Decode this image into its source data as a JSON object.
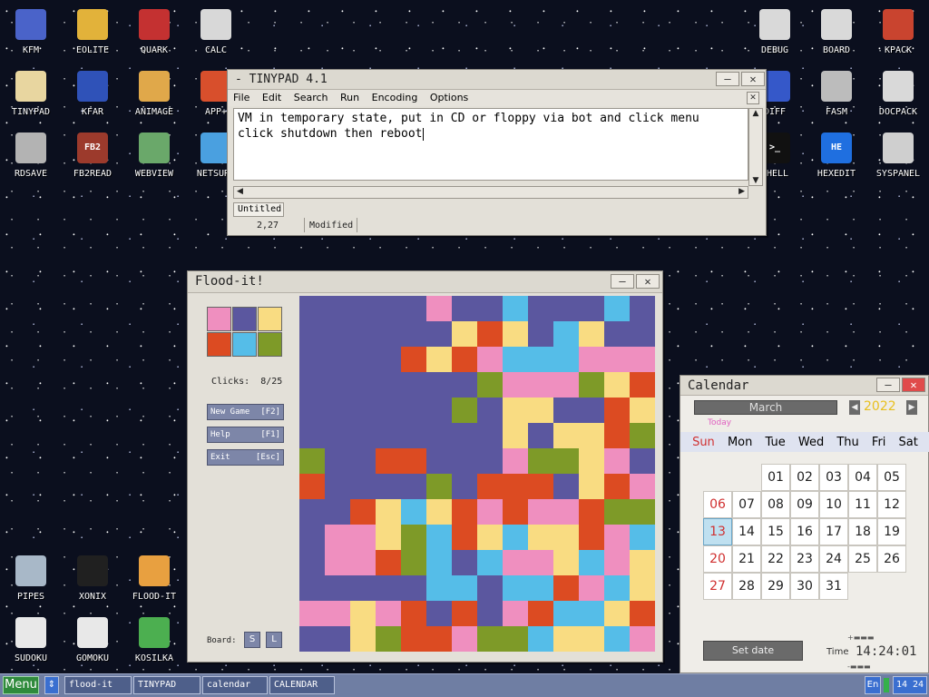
{
  "desktop": {
    "icons": [
      {
        "label": "KFM",
        "glyph": "floppy",
        "color": "#4a63c9",
        "col": 0,
        "row": 0
      },
      {
        "label": "EOLITE",
        "glyph": "folder",
        "color": "#e2b23a",
        "col": 1,
        "row": 0
      },
      {
        "label": "QUARK",
        "glyph": "book",
        "color": "#c43131",
        "col": 2,
        "row": 0
      },
      {
        "label": "CALC",
        "glyph": "calculator",
        "color": "#d8d8d8",
        "col": 3,
        "row": 0
      },
      {
        "label": "TINYPAD",
        "glyph": "notepad",
        "color": "#e8d6a0",
        "col": 0,
        "row": 1
      },
      {
        "label": "KFAR",
        "glyph": "panels",
        "color": "#2f52b8",
        "col": 1,
        "row": 1
      },
      {
        "label": "ANIMAGE",
        "glyph": "pencil",
        "color": "#e0a84a",
        "col": 2,
        "row": 1
      },
      {
        "label": "APP+",
        "glyph": "cube",
        "color": "#d84f2c",
        "col": 3,
        "row": 1
      },
      {
        "label": "RDSAVE",
        "glyph": "disk",
        "color": "#b3b3b3",
        "col": 0,
        "row": 2
      },
      {
        "label": "FB2READ",
        "glyph": "FB2",
        "color": "#9c3a2c",
        "col": 1,
        "row": 2
      },
      {
        "label": "WEBVIEW",
        "glyph": "globe",
        "color": "#6aa86a",
        "col": 2,
        "row": 2
      },
      {
        "label": "NETSURF",
        "glyph": "net",
        "color": "#4aa0e0",
        "col": 3,
        "row": 2
      },
      {
        "label": "DEBUG",
        "glyph": "bug",
        "color": "#d9d9d9",
        "col": "r2",
        "row": 0
      },
      {
        "label": "BOARD",
        "glyph": "board",
        "color": "#d9d9d9",
        "col": "r1",
        "row": 0
      },
      {
        "label": "KPACK",
        "glyph": "wrench",
        "color": "#c9442f",
        "col": "r0",
        "row": 0
      },
      {
        "label": "DIFF",
        "glyph": "diff",
        "color": "#3558c9",
        "col": "r2",
        "row": 1
      },
      {
        "label": "FASM",
        "glyph": "fasm",
        "color": "#bcbcbc",
        "col": "r1",
        "row": 1
      },
      {
        "label": "DOCPACK",
        "glyph": "cabinet",
        "color": "#d9d9d9",
        "col": "r0",
        "row": 1
      },
      {
        "label": "SHELL",
        "glyph": ">_",
        "color": "#111111",
        "col": "r2",
        "row": 2
      },
      {
        "label": "HEXEDIT",
        "glyph": "HE",
        "color": "#1f6fe0",
        "col": "r1",
        "row": 2
      },
      {
        "label": "SYSPANEL",
        "glyph": "sliders",
        "color": "#cfcfcf",
        "col": "r0",
        "row": 2
      },
      {
        "label": "PIPES",
        "glyph": "pipes",
        "color": "#a8b8c8",
        "col": 0,
        "row": 3
      },
      {
        "label": "XONIX",
        "glyph": "xonix",
        "color": "#202020",
        "col": 1,
        "row": 3
      },
      {
        "label": "FLOOD-IT",
        "glyph": "flood",
        "color": "#e8a040",
        "col": 2,
        "row": 3
      },
      {
        "label": "SUDOKU",
        "glyph": "sudoku",
        "color": "#e8e8e8",
        "col": 0,
        "row": 4
      },
      {
        "label": "GOMOKU",
        "glyph": "gomoku",
        "color": "#e8e8e8",
        "col": 1,
        "row": 4
      },
      {
        "label": "KOSILKA",
        "glyph": "mower",
        "color": "#4caf50",
        "col": 2,
        "row": 4
      }
    ]
  },
  "tinypad": {
    "title": "- TINYPAD 4.1",
    "menu": [
      "File",
      "Edit",
      "Search",
      "Run",
      "Encoding",
      "Options"
    ],
    "text_line1": "VM in temporary state, put in CD or floppy via bot and click menu",
    "text_line2": "click shutdown then reboot",
    "tab": "Untitled",
    "position": "2,27",
    "state": "Modified"
  },
  "flood": {
    "title": "Flood-it!",
    "palette": [
      "#ef8fbf",
      "#5b579f",
      "#f9dc82",
      "#dc4b22",
      "#55bde8",
      "#7e9a28"
    ],
    "clicks_label": "Clicks:",
    "clicks_value": "8/25",
    "new_game": "New Game",
    "new_game_key": "[F2]",
    "help": "Help",
    "help_key": "[F1]",
    "exit": "Exit",
    "exit_key": "[Esc]",
    "board_label": "Board:",
    "size_small": "S",
    "size_large": "L",
    "grid": [
      "11111P11BAAABA",
      "111111YRYABYAA",
      "1111RYRPBBBPPP",
      "1111111GPPPGYR",
      "111111GAYYAARY",
      "11111111YAYYRG",
      "GAARRAAAPGGYPA",
      "RAAAAGARRRAYRP",
      "1ARYBYRPRPPRGGR",
      "1PPYGBRYBYYRPB",
      "1PPRGBABPPYBPY",
      "1AAAABBABBRPBY",
      "PPYPRARAPRBBYR",
      "AAYGRRPGGBYYBP"
    ]
  },
  "calendar": {
    "title": "Calendar",
    "month": "March",
    "year": "2022",
    "today_label": "Today",
    "weekdays": [
      "Sun",
      "Mon",
      "Tue",
      "Wed",
      "Thu",
      "Fri",
      "Sat"
    ],
    "weeks": [
      [
        "",
        "",
        "01",
        "02",
        "03",
        "04",
        "05"
      ],
      [
        "06",
        "07",
        "08",
        "09",
        "10",
        "11",
        "12"
      ],
      [
        "13",
        "14",
        "15",
        "16",
        "17",
        "18",
        "19"
      ],
      [
        "20",
        "21",
        "22",
        "23",
        "24",
        "25",
        "26"
      ],
      [
        "27",
        "28",
        "29",
        "30",
        "31",
        "",
        ""
      ]
    ],
    "today": "13",
    "set_date": "Set date",
    "time_label": "Time",
    "time": "14:24:01"
  },
  "taskbar": {
    "menu": "Menu",
    "tasks": [
      "flood-it",
      "TINYPAD",
      "calendar",
      "CALENDAR"
    ],
    "lang": "En",
    "clock": "14 24"
  }
}
